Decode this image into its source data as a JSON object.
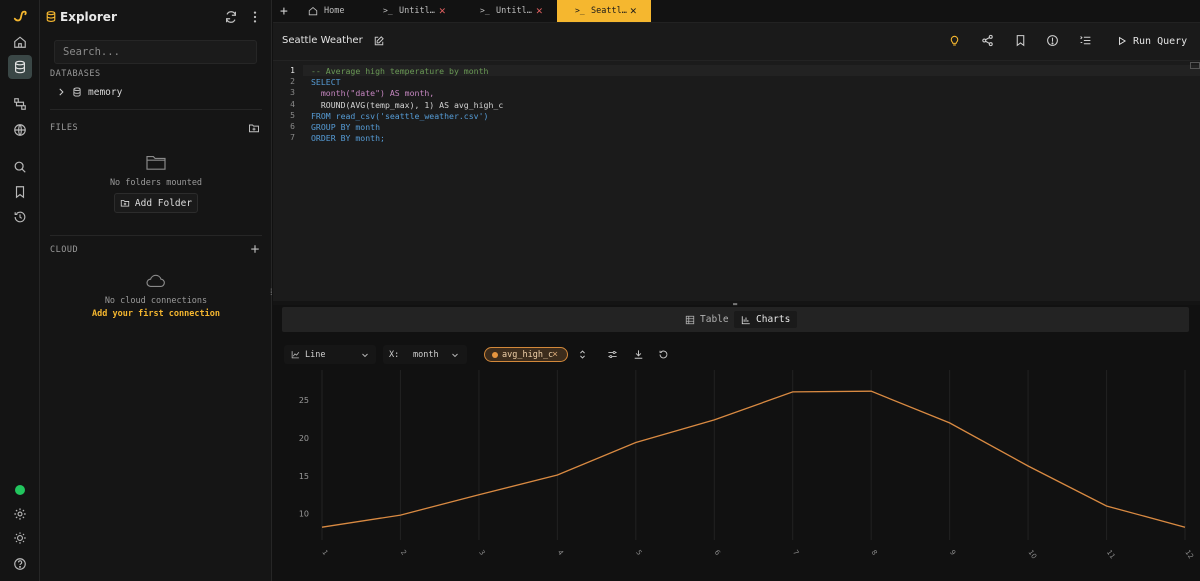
{
  "explorer": {
    "title": "Explorer",
    "search_placeholder": "Search...",
    "databases_label": "DATABASES",
    "db_items": [
      {
        "name": "memory"
      }
    ],
    "files_label": "FILES",
    "files_empty": "No folders mounted",
    "add_folder": "Add Folder",
    "cloud_label": "CLOUD",
    "cloud_empty": "No cloud connections",
    "cloud_add": "Add your first connection"
  },
  "tabs": [
    {
      "label": "Home",
      "active": false
    },
    {
      "label": "Untitl…",
      "active": false
    },
    {
      "label": "Untitl…",
      "active": false
    },
    {
      "label": "Seattl…",
      "active": true
    }
  ],
  "query": {
    "title": "Seattle Weather",
    "run_label": "Run Query"
  },
  "editor": {
    "lines": [
      "-- Average high temperature by month",
      "SELECT",
      "  month(\"date\") AS month,",
      "  ROUND(AVG(temp_max), 1) AS avg_high_c",
      "FROM read_csv('seattle_weather.csv')",
      "GROUP BY month",
      "ORDER BY month;"
    ],
    "line_numbers": [
      "1",
      "2",
      "3",
      "4",
      "5",
      "6",
      "7"
    ]
  },
  "results": {
    "table_label": "Table",
    "charts_label": "Charts",
    "active_view": "Charts"
  },
  "chart_toolbar": {
    "chart_type": "Line",
    "x_label": "X:",
    "x_value": "month",
    "series_chip": "avg_high_c"
  },
  "colors": {
    "accent": "#f5b72f",
    "series": "#d98a42",
    "status_online": "#22c55e"
  },
  "chart_data": {
    "type": "line",
    "x": [
      1,
      2,
      3,
      4,
      5,
      6,
      7,
      8,
      9,
      10,
      11,
      12
    ],
    "x_tick_labels": [
      "1",
      "2",
      "3",
      "4",
      "5",
      "6",
      "7",
      "8",
      "9",
      "10",
      "11",
      "12"
    ],
    "series": [
      {
        "name": "avg_high_c",
        "values": [
          8.2,
          9.8,
          12.5,
          15.1,
          19.4,
          22.4,
          26.1,
          26.2,
          22.0,
          16.3,
          11.0,
          8.2
        ]
      }
    ],
    "y_ticks": [
      10,
      15,
      20,
      25
    ],
    "ylim": [
      6.5,
      29
    ],
    "xlabel": "",
    "ylabel": "",
    "title": "",
    "grid": true,
    "legend": "none"
  }
}
